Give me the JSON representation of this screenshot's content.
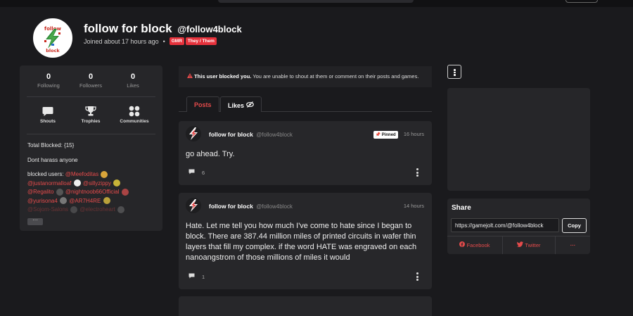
{
  "profile": {
    "display_name": "follow for block",
    "username": "@follow4block",
    "joined": "Joined about 17 hours ago",
    "dot": "•",
    "tags": [
      "GMR",
      "They / Them"
    ],
    "avatar_text_top": "follow",
    "avatar_text_bottom": "block"
  },
  "stats": [
    {
      "num": "0",
      "label": "Following"
    },
    {
      "num": "0",
      "label": "Followers"
    },
    {
      "num": "0",
      "label": "Likes"
    }
  ],
  "nav": [
    {
      "label": "Shouts",
      "icon": "chat-bubble-icon"
    },
    {
      "label": "Trophies",
      "icon": "trophy-icon"
    },
    {
      "label": "Communities",
      "icon": "grid-dots-icon"
    }
  ],
  "bio": {
    "line1": "Total Blocked: {15}",
    "line2": "Dont harass anyone",
    "blocked_label": "blocked users:",
    "mentions": [
      "@Meefoditas",
      "@justanormalloaf",
      "@sillyzippy",
      "@Regalito",
      "@nightnoob66Official",
      "@yurisona4",
      "@AR7H4RE",
      "@Sojom-Salons",
      "@electroheart"
    ]
  },
  "more_label": "···",
  "blocked_notice": {
    "bold": "This user blocked you.",
    "rest": " You are unable to shout at them or comment on their posts and games."
  },
  "tabs": [
    {
      "label": "Posts",
      "active": true
    },
    {
      "label": "Likes",
      "active": false
    }
  ],
  "posts": [
    {
      "author": "follow for block",
      "handle": "@follow4block",
      "pinned": "Pinned",
      "time": "16 hours",
      "body": "go ahead. Try.",
      "comments": "6"
    },
    {
      "author": "follow for block",
      "handle": "@follow4block",
      "time": "14 hours",
      "body": "Hate. Let me tell you how much I've come to hate since I began to block. There are 387.44 million miles of printed circuits in wafer thin layers that fill my complex. if the word HATE was engraved on each nanoangstrom of those millions of miles it would",
      "comments": "1"
    }
  ],
  "share": {
    "title": "Share",
    "url": "https://gamejolt.com/@follow4block",
    "copy_label": "Copy",
    "facebook": "Facebook",
    "twitter": "Twitter",
    "more": "···"
  },
  "colors": {
    "accent": "#e64b4b",
    "background": "#1a1a1d",
    "panel": "#262629"
  }
}
